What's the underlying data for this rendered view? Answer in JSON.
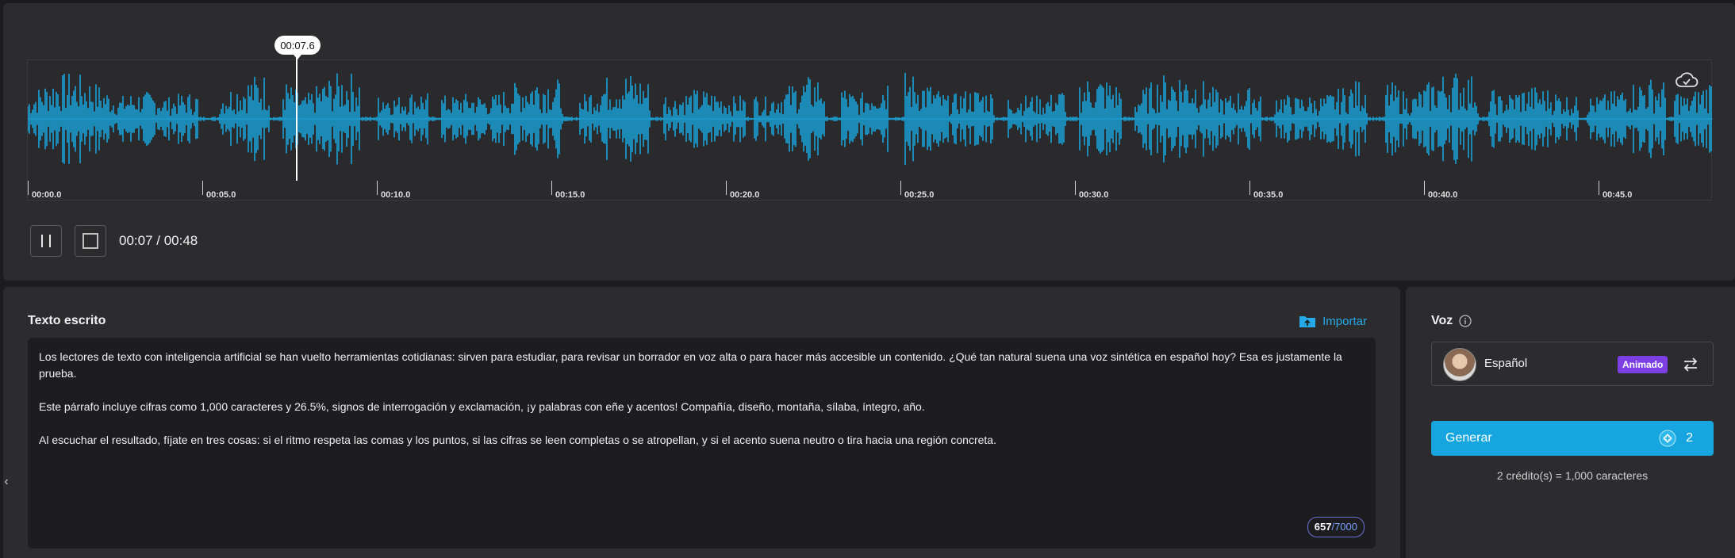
{
  "player": {
    "playhead_time": "00:07.6",
    "time_readout": "00:07 / 00:48",
    "ticks": [
      "00:00.0",
      "00:05.0",
      "00:10.0",
      "00:15.0",
      "00:20.0",
      "00:25.0",
      "00:30.0",
      "00:35.0",
      "00:40.0",
      "00:45.0"
    ]
  },
  "editor": {
    "title": "Texto escrito",
    "import_label": "Importar",
    "paragraphs": [
      "Los lectores de texto con inteligencia artificial se han vuelto herramientas cotidianas: sirven para estudiar, para revisar un borrador en voz alta o para hacer más accesible un contenido. ¿Qué tan natural suena una voz sintética en español hoy? Esa es justamente la prueba.",
      "Este párrafo incluye cifras como 1,000 caracteres y 26.5%, signos de interrogación y exclamación, ¡y palabras con eñe y acentos! Compañía, diseño, montaña, sílaba, íntegro, año.",
      "Al escuchar el resultado, fíjate en tres cosas: si el ritmo respeta las comas y los puntos, si las cifras se leen completas o se atropellan, y si el acento suena neutro o tira hacia una región concreta."
    ],
    "char_count": "657",
    "char_max": "/7000"
  },
  "voice": {
    "title": "Voz",
    "name": "Español",
    "badge": "Animado",
    "generate_label": "Generar",
    "generate_credits": "2",
    "credit_note": "2 crédito(s) = 1,000 caracteres"
  },
  "colors": {
    "waveform": "#1aa3d9",
    "accent": "#17a5e0",
    "badge": "#7b3fe4"
  }
}
